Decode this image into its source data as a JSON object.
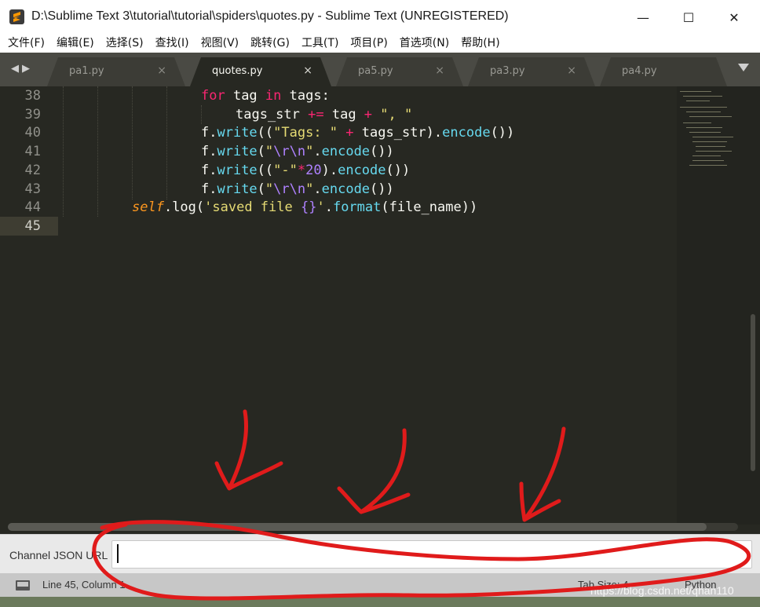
{
  "window": {
    "title": "D:\\Sublime Text 3\\tutorial\\tutorial\\spiders\\quotes.py - Sublime Text (UNREGISTERED)",
    "minimize_glyph": "—",
    "maximize_glyph": "☐",
    "close_glyph": "✕"
  },
  "menu": [
    "文件(F)",
    "编辑(E)",
    "选择(S)",
    "查找(I)",
    "视图(V)",
    "跳转(G)",
    "工具(T)",
    "项目(P)",
    "首选项(N)",
    "帮助(H)"
  ],
  "tabs": [
    {
      "label": "pa1.py",
      "active": false
    },
    {
      "label": "quotes.py",
      "active": true
    },
    {
      "label": "pa5.py",
      "active": false
    },
    {
      "label": "pa3.py",
      "active": false
    },
    {
      "label": "pa4.py",
      "active": false
    }
  ],
  "tab_close_glyph": "×",
  "line_numbers": [
    "38",
    "39",
    "40",
    "41",
    "42",
    "43",
    "44",
    "45"
  ],
  "current_line": "45",
  "panel": {
    "label": "Channel JSON URL",
    "value": ""
  },
  "status": {
    "position": "Line 45, Column 1",
    "tab_size": "Tab Size: 4",
    "syntax": "Python"
  },
  "watermark": "https://blog.csdn.net/qhan110",
  "colors": {
    "editor_bg": "#272822",
    "keyword": "#f92672",
    "function": "#66d9ef",
    "string": "#e6db74",
    "constant": "#ae81ff",
    "self": "#fd971f",
    "annotation": "#e01b1b"
  },
  "icons": {
    "app": "sublime-text-icon",
    "nav": "tab-nav-arrows-icon",
    "tab_menu": "tab-list-triangle-icon",
    "status": "console-toggle-icon"
  }
}
